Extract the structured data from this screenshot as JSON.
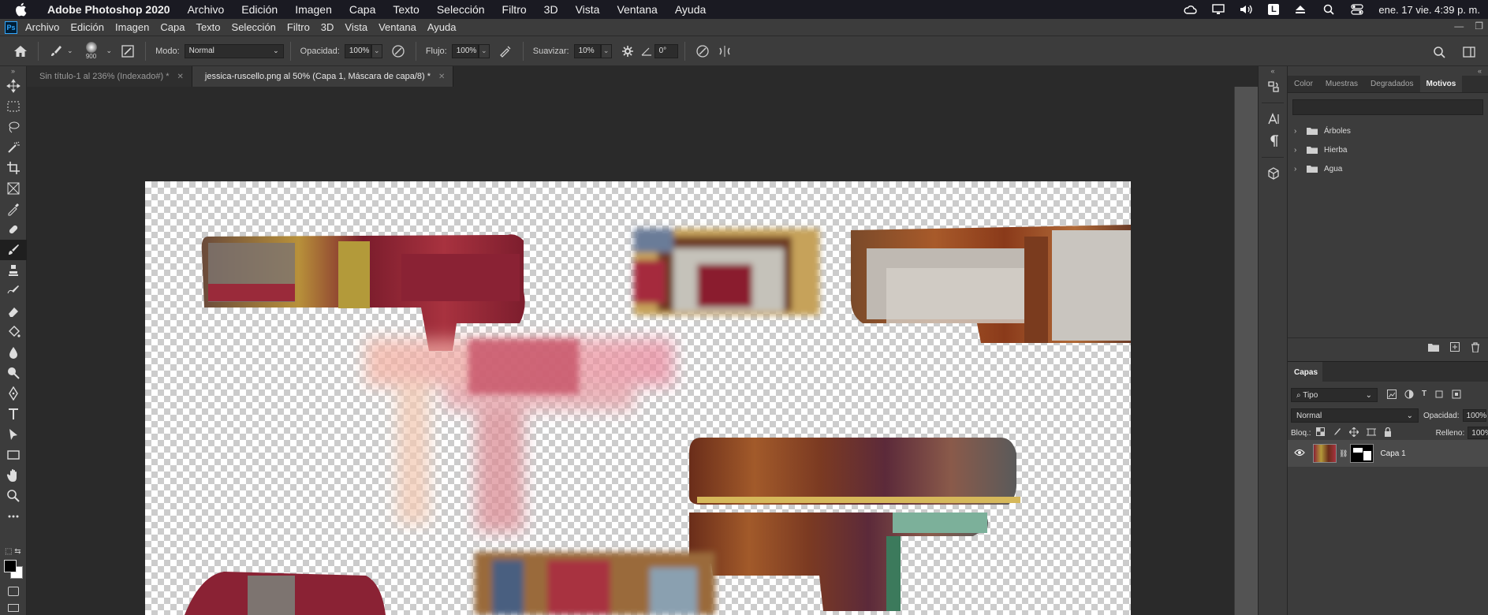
{
  "mac_menubar": {
    "app_name": "Adobe Photoshop 2020",
    "menus": [
      "Archivo",
      "Edición",
      "Imagen",
      "Capa",
      "Texto",
      "Selección",
      "Filtro",
      "3D",
      "Vista",
      "Ventana",
      "Ayuda"
    ],
    "status_icons": [
      "creative-cloud-icon",
      "display-icon",
      "volume-icon",
      "keyboard-language-icon",
      "eject-icon",
      "search-icon",
      "control-center-icon"
    ],
    "keyboard_letter": "L",
    "clock": "ene. 17 vie. 4:39 p. m."
  },
  "ps_menubar": {
    "logo": "Ps",
    "menus": [
      "Archivo",
      "Edición",
      "Imagen",
      "Capa",
      "Texto",
      "Selección",
      "Filtro",
      "3D",
      "Vista",
      "Ventana",
      "Ayuda"
    ]
  },
  "options_bar": {
    "brush_size": "900",
    "mode_label": "Modo:",
    "mode_value": "Normal",
    "opacity_label": "Opacidad:",
    "opacity_value": "100%",
    "flow_label": "Flujo:",
    "flow_value": "100%",
    "smoothing_label": "Suavizar:",
    "smoothing_value": "10%",
    "angle_value": "0°"
  },
  "tabs": [
    {
      "label": "Sin título-1 al 236% (Indexado#) *",
      "active": false
    },
    {
      "label": "jessica-ruscello.png al 50% (Capa 1, Máscara de capa/8) *",
      "active": true
    }
  ],
  "tools": [
    "move-tool",
    "marquee-tool",
    "lasso-tool",
    "magic-wand-tool",
    "crop-tool",
    "frame-tool",
    "eyedropper-tool",
    "healing-brush-tool",
    "brush-tool",
    "clone-stamp-tool",
    "history-brush-tool",
    "eraser-tool",
    "paint-bucket-tool",
    "blur-tool",
    "dodge-tool",
    "pen-tool",
    "type-tool",
    "path-selection-tool",
    "rectangle-tool",
    "hand-tool",
    "zoom-tool",
    "more-tools"
  ],
  "colors": {
    "foreground": "#000000",
    "background": "#ffffff",
    "accent": "#31a8ff"
  },
  "patterns_panel": {
    "tabs": [
      "Color",
      "Muestras",
      "Degradados",
      "Motivos"
    ],
    "active_tab": "Motivos",
    "folders": [
      "Árboles",
      "Hierba",
      "Agua"
    ]
  },
  "layers_panel": {
    "title": "Capas",
    "filter_value": "Tipo",
    "blend_mode": "Normal",
    "opacity_label": "Opacidad:",
    "opacity_value": "100%",
    "lock_label": "Bloq.:",
    "fill_label": "Relleno:",
    "fill_value": "100%",
    "layers": [
      {
        "name": "Capa 1",
        "visible": true,
        "has_mask": true
      }
    ]
  }
}
